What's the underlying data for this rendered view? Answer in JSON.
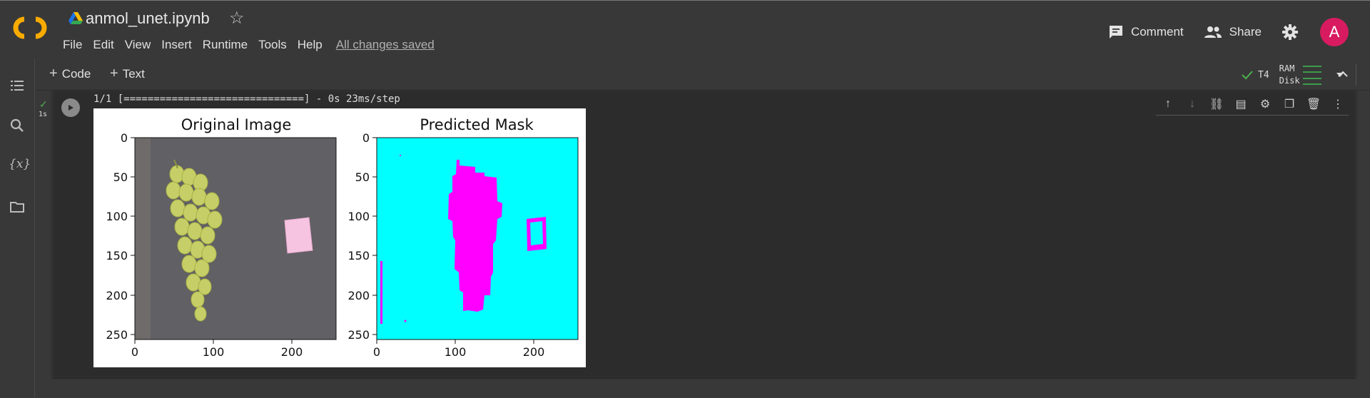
{
  "header": {
    "notebook_title": "anmol_unet.ipynb",
    "menu": [
      "File",
      "Edit",
      "View",
      "Insert",
      "Runtime",
      "Tools",
      "Help"
    ],
    "save_status": "All changes saved",
    "comment_label": "Comment",
    "share_label": "Share",
    "avatar_letter": "A",
    "avatar_color": "#d81b60"
  },
  "toolbar": {
    "code_label": "Code",
    "text_label": "Text",
    "runtime": "T4",
    "ram_label": "RAM",
    "disk_label": "Disk"
  },
  "cell": {
    "exec_time": "1s",
    "output_text": "1/1 [==============================] - 0s 23ms/step"
  },
  "figure": {
    "panels": [
      {
        "title": "Original Image",
        "xticks": [
          "0",
          "100",
          "200"
        ],
        "yticks": [
          "0",
          "50",
          "100",
          "150",
          "200",
          "250"
        ]
      },
      {
        "title": "Predicted Mask",
        "xticks": [
          "0",
          "100",
          "200"
        ],
        "yticks": [
          "0",
          "50",
          "100",
          "150",
          "200",
          "250"
        ]
      }
    ],
    "mask_colors": {
      "background": "#00ffff",
      "foreground": "#ff00ff"
    }
  },
  "icons": {
    "rail": [
      "table-of-contents-icon",
      "search-icon",
      "variables-icon",
      "files-icon"
    ],
    "cell_toolbar": [
      "move-up-icon",
      "move-down-icon",
      "link-icon",
      "comment-icon",
      "settings-icon",
      "mirror-cell-icon",
      "delete-icon",
      "more-icon"
    ]
  }
}
